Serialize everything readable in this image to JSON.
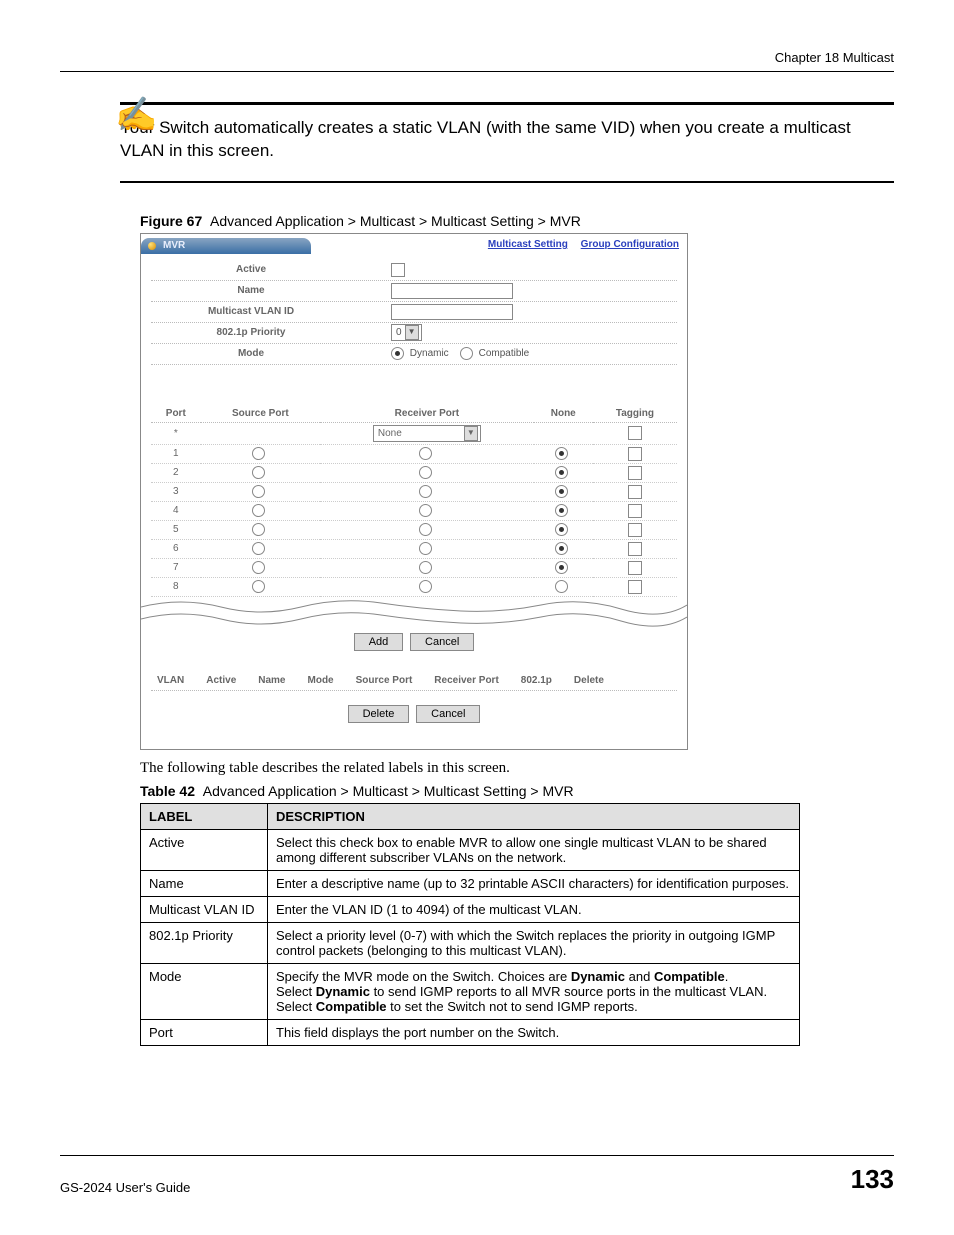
{
  "header": {
    "chapter": "Chapter 18 Multicast"
  },
  "note": {
    "text": "Your Switch automatically creates a static VLAN (with the same VID) when you create a multicast VLAN in this screen."
  },
  "figure": {
    "label": "Figure 67",
    "caption": "Advanced Application > Multicast > Multicast Setting > MVR",
    "tab_title": "MVR",
    "link_multicast_setting": "Multicast Setting",
    "link_group_config": "Group Configuration",
    "rows": {
      "active": "Active",
      "name": "Name",
      "vlan_id": "Multicast VLAN ID",
      "priority": "802.1p Priority",
      "priority_value": "0",
      "mode": "Mode",
      "mode_dynamic": "Dynamic",
      "mode_compatible": "Compatible"
    },
    "port_headers": {
      "port": "Port",
      "source": "Source Port",
      "receiver": "Receiver Port",
      "none": "None",
      "tagging": "Tagging"
    },
    "star_row_select": "None",
    "port_rows": [
      "1",
      "2",
      "3",
      "4",
      "5",
      "6",
      "7",
      "8"
    ],
    "buttons": {
      "add": "Add",
      "cancel": "Cancel",
      "delete": "Delete"
    },
    "summary_headers": {
      "vlan": "VLAN",
      "active": "Active",
      "name": "Name",
      "mode": "Mode",
      "source": "Source Port",
      "receiver": "Receiver Port",
      "p8021p": "802.1p",
      "delete": "Delete"
    }
  },
  "body": {
    "following_text": "The following table describes the related labels in this screen."
  },
  "table": {
    "label": "Table 42",
    "caption": "Advanced Application > Multicast > Multicast Setting > MVR",
    "header_label": "LABEL",
    "header_desc": "DESCRIPTION",
    "rows": [
      {
        "label": "Active",
        "desc": "Select this check box to enable MVR to allow one single multicast VLAN to be shared among different subscriber VLANs on the network."
      },
      {
        "label": "Name",
        "desc": "Enter a descriptive name (up to 32 printable ASCII characters) for identification purposes."
      },
      {
        "label": "Multicast VLAN ID",
        "desc": "Enter the VLAN ID (1 to 4094) of the multicast VLAN."
      },
      {
        "label": "802.1p Priority",
        "desc": "Select a priority level (0-7) with which the Switch replaces the priority in outgoing IGMP control packets (belonging to this multicast VLAN)."
      },
      {
        "label": "Port",
        "desc": "This field displays the port number on the Switch."
      }
    ],
    "mode_row": {
      "label": "Mode",
      "l1a": "Specify the MVR mode on the Switch. Choices are ",
      "l1b": "Dynamic",
      "l1c": " and ",
      "l1d": "Compatible",
      "l1e": ".",
      "l2a": "Select ",
      "l2b": "Dynamic",
      "l2c": " to send IGMP reports to all MVR source ports in the multicast VLAN.",
      "l3a": "Select ",
      "l3b": "Compatible",
      "l3c": " to set the Switch not to send IGMP reports."
    }
  },
  "footer": {
    "guide": "GS-2024 User's Guide",
    "page": "133"
  }
}
